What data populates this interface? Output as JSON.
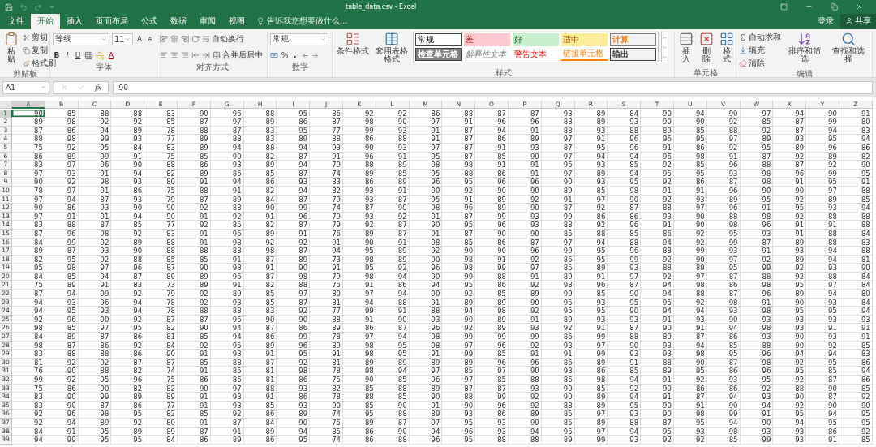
{
  "title_bar": {
    "title": "table_data.csv - Excel"
  },
  "tabs": [
    {
      "label": "文件",
      "selected": false
    },
    {
      "label": "开始",
      "selected": true
    },
    {
      "label": "插入",
      "selected": false
    },
    {
      "label": "页面布局",
      "selected": false
    },
    {
      "label": "公式",
      "selected": false
    },
    {
      "label": "数据",
      "selected": false
    },
    {
      "label": "审阅",
      "selected": false
    },
    {
      "label": "视图",
      "selected": false
    }
  ],
  "tell_me": "告诉我您想要做什么...",
  "account": {
    "sign_in": "登录",
    "share": "共享"
  },
  "ribbon": {
    "clipboard": {
      "label": "剪贴板",
      "paste": "粘贴",
      "cut": "剪切",
      "copy": "复制",
      "painter": "格式刷"
    },
    "font": {
      "label": "字体",
      "family": "等线",
      "size": "11",
      "grow": "A",
      "shrink": "A",
      "bold": "B",
      "italic": "I",
      "underline": "U",
      "font_color_letter": "A"
    },
    "alignment": {
      "label": "对齐方式",
      "wrap": "自动换行",
      "merge": "合并后居中"
    },
    "number": {
      "label": "数字",
      "format": "常规",
      "percent": "%",
      "comma": ","
    },
    "styles": {
      "label": "样式",
      "conditional": "条件格式",
      "table": "套用表格格式",
      "cells": [
        {
          "label": "常规",
          "kind": "normal"
        },
        {
          "label": "差",
          "kind": "bad"
        },
        {
          "label": "好",
          "kind": "good"
        },
        {
          "label": "适中",
          "kind": "neutral"
        },
        {
          "label": "计算",
          "kind": "calc"
        },
        {
          "label": "检查单元格",
          "kind": "check"
        },
        {
          "label": "解释性文本",
          "kind": "explanatory"
        },
        {
          "label": "警告文本",
          "kind": "warning"
        },
        {
          "label": "链接单元格",
          "kind": "linked"
        },
        {
          "label": "输出",
          "kind": "output"
        }
      ]
    },
    "cells": {
      "label": "单元格",
      "insert": "插入",
      "delete": "删除",
      "format": "格式"
    },
    "editing": {
      "label": "编辑",
      "autosum": "自动求和",
      "fill": "填充",
      "clear": "清除",
      "sort": "排序和筛选",
      "find": "查找和选择"
    }
  },
  "formula_bar": {
    "name_box": "A1",
    "function_label": "fx",
    "value": "90"
  },
  "sheet": {
    "columns": [
      {
        "label": "A",
        "selected": true
      },
      {
        "label": "B",
        "selected": false
      },
      {
        "label": "C",
        "selected": false
      },
      {
        "label": "D",
        "selected": false
      },
      {
        "label": "E",
        "selected": false
      },
      {
        "label": "F",
        "selected": false
      },
      {
        "label": "G",
        "selected": false
      },
      {
        "label": "H",
        "selected": false
      },
      {
        "label": "I",
        "selected": false
      },
      {
        "label": "J",
        "selected": false
      },
      {
        "label": "K",
        "selected": false
      },
      {
        "label": "L",
        "selected": false
      },
      {
        "label": "M",
        "selected": false
      },
      {
        "label": "N",
        "selected": false
      },
      {
        "label": "O",
        "selected": false
      },
      {
        "label": "P",
        "selected": false
      },
      {
        "label": "Q",
        "selected": false
      },
      {
        "label": "R",
        "selected": false
      },
      {
        "label": "S",
        "selected": false
      },
      {
        "label": "T",
        "selected": false
      },
      {
        "label": "U",
        "selected": false
      },
      {
        "label": "V",
        "selected": false
      },
      {
        "label": "W",
        "selected": false
      },
      {
        "label": "X",
        "selected": false
      },
      {
        "label": "Y",
        "selected": false
      },
      {
        "label": "Z",
        "selected": false
      }
    ],
    "rows": [
      {
        "header": "1",
        "selected": true,
        "cells": [
          "90",
          "85",
          "88",
          "88",
          "83",
          "90",
          "96",
          "88",
          "95",
          "86",
          "92",
          "92",
          "86",
          "88",
          "87",
          "87",
          "93",
          "89",
          "84",
          "90",
          "94",
          "90",
          "97",
          "94",
          "90",
          "91"
        ]
      },
      {
        "header": "2",
        "selected": false,
        "cells": [
          "89",
          "98",
          "92",
          "92",
          "85",
          "87",
          "97",
          "89",
          "86",
          "87",
          "98",
          "90",
          "97",
          "91",
          "96",
          "96",
          "88",
          "89",
          "93",
          "90",
          "90",
          "92",
          "85",
          "87",
          "99",
          "80"
        ]
      },
      {
        "header": "3",
        "selected": false,
        "cells": [
          "87",
          "86",
          "94",
          "89",
          "78",
          "88",
          "87",
          "83",
          "95",
          "77",
          "99",
          "93",
          "91",
          "87",
          "94",
          "91",
          "88",
          "93",
          "88",
          "89",
          "85",
          "88",
          "92",
          "87",
          "94",
          "83"
        ]
      },
      {
        "header": "4",
        "selected": false,
        "cells": [
          "88",
          "98",
          "99",
          "93",
          "77",
          "89",
          "88",
          "83",
          "89",
          "88",
          "86",
          "88",
          "91",
          "87",
          "86",
          "89",
          "97",
          "91",
          "96",
          "96",
          "95",
          "97",
          "89",
          "93",
          "95",
          "94"
        ]
      },
      {
        "header": "5",
        "selected": false,
        "cells": [
          "75",
          "92",
          "95",
          "84",
          "83",
          "89",
          "94",
          "88",
          "94",
          "93",
          "90",
          "93",
          "97",
          "87",
          "91",
          "93",
          "87",
          "95",
          "96",
          "91",
          "86",
          "92",
          "95",
          "89",
          "96",
          "86"
        ]
      },
      {
        "header": "6",
        "selected": false,
        "cells": [
          "86",
          "89",
          "99",
          "91",
          "75",
          "85",
          "90",
          "82",
          "87",
          "91",
          "96",
          "91",
          "95",
          "87",
          "85",
          "90",
          "97",
          "94",
          "94",
          "96",
          "98",
          "91",
          "87",
          "92",
          "89",
          "82"
        ]
      },
      {
        "header": "7",
        "selected": false,
        "cells": [
          "83",
          "97",
          "96",
          "90",
          "88",
          "86",
          "93",
          "89",
          "94",
          "79",
          "88",
          "89",
          "98",
          "98",
          "91",
          "91",
          "96",
          "93",
          "85",
          "92",
          "85",
          "96",
          "88",
          "87",
          "92",
          "90"
        ]
      },
      {
        "header": "8",
        "selected": false,
        "cells": [
          "97",
          "93",
          "91",
          "94",
          "82",
          "89",
          "86",
          "85",
          "87",
          "74",
          "89",
          "85",
          "95",
          "88",
          "86",
          "91",
          "97",
          "89",
          "94",
          "95",
          "95",
          "93",
          "98",
          "96",
          "99",
          "95"
        ]
      },
      {
        "header": "9",
        "selected": false,
        "cells": [
          "90",
          "92",
          "98",
          "93",
          "80",
          "91",
          "94",
          "86",
          "93",
          "83",
          "86",
          "89",
          "96",
          "95",
          "96",
          "96",
          "90",
          "93",
          "95",
          "92",
          "86",
          "87",
          "98",
          "91",
          "95",
          "91"
        ]
      },
      {
        "header": "10",
        "selected": false,
        "cells": [
          "78",
          "97",
          "91",
          "86",
          "75",
          "88",
          "91",
          "82",
          "94",
          "82",
          "93",
          "91",
          "90",
          "92",
          "90",
          "90",
          "89",
          "85",
          "98",
          "91",
          "91",
          "96",
          "90",
          "90",
          "97",
          "88"
        ]
      },
      {
        "header": "11",
        "selected": false,
        "cells": [
          "97",
          "94",
          "87",
          "93",
          "79",
          "87",
          "89",
          "84",
          "87",
          "79",
          "93",
          "87",
          "95",
          "91",
          "89",
          "92",
          "91",
          "97",
          "90",
          "92",
          "93",
          "89",
          "95",
          "92",
          "89",
          "85"
        ]
      },
      {
        "header": "12",
        "selected": false,
        "cells": [
          "90",
          "86",
          "93",
          "90",
          "90",
          "92",
          "88",
          "90",
          "99",
          "74",
          "87",
          "90",
          "98",
          "96",
          "89",
          "90",
          "87",
          "92",
          "87",
          "88",
          "97",
          "96",
          "91",
          "95",
          "93",
          "94"
        ]
      },
      {
        "header": "13",
        "selected": false,
        "cells": [
          "97",
          "91",
          "91",
          "94",
          "90",
          "91",
          "92",
          "91",
          "96",
          "79",
          "93",
          "92",
          "91",
          "87",
          "99",
          "93",
          "99",
          "86",
          "86",
          "93",
          "90",
          "88",
          "98",
          "92",
          "88",
          "88"
        ]
      },
      {
        "header": "14",
        "selected": false,
        "cells": [
          "83",
          "88",
          "87",
          "85",
          "77",
          "92",
          "85",
          "82",
          "87",
          "79",
          "92",
          "87",
          "90",
          "95",
          "96",
          "93",
          "88",
          "92",
          "96",
          "91",
          "90",
          "98",
          "96",
          "91",
          "91",
          "88"
        ]
      },
      {
        "header": "15",
        "selected": false,
        "cells": [
          "87",
          "96",
          "98",
          "92",
          "83",
          "91",
          "96",
          "89",
          "91",
          "76",
          "89",
          "87",
          "91",
          "87",
          "90",
          "90",
          "85",
          "88",
          "85",
          "86",
          "92",
          "95",
          "93",
          "91",
          "88",
          "84"
        ]
      },
      {
        "header": "16",
        "selected": false,
        "cells": [
          "84",
          "99",
          "92",
          "89",
          "88",
          "91",
          "98",
          "92",
          "92",
          "91",
          "90",
          "91",
          "98",
          "85",
          "86",
          "87",
          "97",
          "94",
          "88",
          "94",
          "92",
          "99",
          "87",
          "89",
          "88",
          "83"
        ]
      },
      {
        "header": "17",
        "selected": false,
        "cells": [
          "89",
          "87",
          "93",
          "90",
          "88",
          "88",
          "88",
          "98",
          "87",
          "94",
          "95",
          "89",
          "92",
          "90",
          "90",
          "96",
          "99",
          "95",
          "96",
          "88",
          "99",
          "93",
          "91",
          "93",
          "94",
          "88"
        ]
      },
      {
        "header": "18",
        "selected": false,
        "cells": [
          "82",
          "95",
          "92",
          "88",
          "85",
          "85",
          "91",
          "87",
          "89",
          "73",
          "98",
          "89",
          "90",
          "98",
          "91",
          "92",
          "86",
          "95",
          "99",
          "92",
          "90",
          "97",
          "92",
          "89",
          "94",
          "81"
        ]
      },
      {
        "header": "19",
        "selected": false,
        "cells": [
          "95",
          "98",
          "97",
          "96",
          "87",
          "90",
          "98",
          "91",
          "90",
          "91",
          "95",
          "92",
          "96",
          "98",
          "99",
          "97",
          "85",
          "89",
          "93",
          "88",
          "89",
          "95",
          "99",
          "92",
          "93",
          "90"
        ]
      },
      {
        "header": "20",
        "selected": false,
        "cells": [
          "84",
          "85",
          "94",
          "87",
          "80",
          "89",
          "96",
          "87",
          "98",
          "79",
          "98",
          "94",
          "90",
          "99",
          "88",
          "91",
          "89",
          "91",
          "97",
          "92",
          "97",
          "87",
          "88",
          "92",
          "88",
          "84"
        ]
      },
      {
        "header": "21",
        "selected": false,
        "cells": [
          "75",
          "89",
          "91",
          "83",
          "73",
          "89",
          "91",
          "82",
          "88",
          "75",
          "91",
          "86",
          "94",
          "95",
          "86",
          "92",
          "98",
          "96",
          "87",
          "94",
          "98",
          "86",
          "98",
          "95",
          "97",
          "84"
        ]
      },
      {
        "header": "22",
        "selected": false,
        "cells": [
          "87",
          "94",
          "99",
          "92",
          "79",
          "92",
          "89",
          "85",
          "97",
          "80",
          "97",
          "94",
          "90",
          "92",
          "85",
          "89",
          "99",
          "85",
          "90",
          "94",
          "88",
          "87",
          "96",
          "89",
          "94",
          "80"
        ]
      },
      {
        "header": "23",
        "selected": false,
        "cells": [
          "94",
          "93",
          "96",
          "94",
          "78",
          "92",
          "93",
          "85",
          "87",
          "81",
          "94",
          "88",
          "91",
          "89",
          "89",
          "90",
          "95",
          "93",
          "95",
          "95",
          "92",
          "98",
          "91",
          "90",
          "93",
          "84"
        ]
      },
      {
        "header": "24",
        "selected": false,
        "cells": [
          "94",
          "95",
          "93",
          "94",
          "78",
          "88",
          "88",
          "83",
          "92",
          "77",
          "99",
          "91",
          "88",
          "94",
          "98",
          "92",
          "95",
          "95",
          "90",
          "94",
          "94",
          "93",
          "98",
          "95",
          "95",
          "94"
        ]
      },
      {
        "header": "25",
        "selected": false,
        "cells": [
          "92",
          "96",
          "90",
          "92",
          "87",
          "87",
          "96",
          "90",
          "90",
          "88",
          "91",
          "90",
          "93",
          "90",
          "89",
          "91",
          "89",
          "93",
          "93",
          "91",
          "93",
          "90",
          "93",
          "93",
          "93",
          "93"
        ]
      },
      {
        "header": "26",
        "selected": false,
        "cells": [
          "98",
          "85",
          "97",
          "95",
          "82",
          "90",
          "94",
          "87",
          "86",
          "89",
          "86",
          "87",
          "96",
          "92",
          "89",
          "93",
          "92",
          "91",
          "87",
          "90",
          "91",
          "94",
          "98",
          "93",
          "91",
          "91"
        ]
      },
      {
        "header": "27",
        "selected": false,
        "cells": [
          "84",
          "89",
          "87",
          "86",
          "81",
          "85",
          "94",
          "86",
          "99",
          "78",
          "97",
          "94",
          "98",
          "99",
          "99",
          "99",
          "86",
          "99",
          "88",
          "89",
          "87",
          "86",
          "93",
          "90",
          "93",
          "91"
        ]
      },
      {
        "header": "28",
        "selected": false,
        "cells": [
          "98",
          "87",
          "86",
          "92",
          "84",
          "92",
          "95",
          "89",
          "96",
          "89",
          "98",
          "95",
          "98",
          "97",
          "96",
          "92",
          "93",
          "97",
          "90",
          "93",
          "94",
          "85",
          "88",
          "90",
          "92",
          "85"
        ]
      },
      {
        "header": "29",
        "selected": false,
        "cells": [
          "83",
          "88",
          "88",
          "86",
          "90",
          "91",
          "93",
          "91",
          "95",
          "91",
          "98",
          "95",
          "91",
          "99",
          "85",
          "91",
          "91",
          "99",
          "93",
          "93",
          "98",
          "95",
          "96",
          "94",
          "94",
          "83"
        ]
      },
      {
        "header": "30",
        "selected": false,
        "cells": [
          "81",
          "92",
          "92",
          "87",
          "87",
          "85",
          "88",
          "87",
          "92",
          "81",
          "89",
          "89",
          "89",
          "89",
          "96",
          "96",
          "86",
          "89",
          "91",
          "88",
          "90",
          "87",
          "98",
          "92",
          "95",
          "86"
        ]
      },
      {
        "header": "31",
        "selected": false,
        "cells": [
          "76",
          "90",
          "88",
          "82",
          "74",
          "91",
          "85",
          "81",
          "98",
          "78",
          "98",
          "94",
          "97",
          "85",
          "97",
          "90",
          "93",
          "86",
          "85",
          "89",
          "95",
          "86",
          "96",
          "95",
          "85",
          "94"
        ]
      },
      {
        "header": "32",
        "selected": false,
        "cells": [
          "99",
          "92",
          "95",
          "96",
          "75",
          "86",
          "86",
          "81",
          "86",
          "75",
          "90",
          "85",
          "96",
          "97",
          "85",
          "88",
          "86",
          "98",
          "94",
          "91",
          "92",
          "93",
          "95",
          "92",
          "87",
          "86"
        ]
      },
      {
        "header": "33",
        "selected": false,
        "cells": [
          "75",
          "86",
          "90",
          "82",
          "82",
          "90",
          "97",
          "88",
          "93",
          "82",
          "85",
          "88",
          "89",
          "87",
          "87",
          "93",
          "90",
          "85",
          "92",
          "90",
          "86",
          "86",
          "92",
          "88",
          "90",
          "85"
        ]
      },
      {
        "header": "34",
        "selected": false,
        "cells": [
          "83",
          "90",
          "99",
          "89",
          "89",
          "91",
          "93",
          "91",
          "86",
          "78",
          "88",
          "85",
          "90",
          "88",
          "99",
          "92",
          "90",
          "89",
          "94",
          "91",
          "87",
          "94",
          "93",
          "90",
          "87",
          "92"
        ]
      },
      {
        "header": "35",
        "selected": false,
        "cells": [
          "83",
          "90",
          "87",
          "86",
          "77",
          "91",
          "93",
          "85",
          "93",
          "90",
          "85",
          "90",
          "91",
          "90",
          "96",
          "92",
          "88",
          "89",
          "95",
          "90",
          "91",
          "90",
          "94",
          "92",
          "90",
          "90"
        ]
      },
      {
        "header": "36",
        "selected": false,
        "cells": [
          "92",
          "96",
          "98",
          "95",
          "82",
          "85",
          "92",
          "86",
          "89",
          "74",
          "95",
          "88",
          "89",
          "93",
          "86",
          "89",
          "85",
          "97",
          "93",
          "90",
          "98",
          "99",
          "91",
          "95",
          "94",
          "95"
        ]
      },
      {
        "header": "37",
        "selected": false,
        "cells": [
          "92",
          "94",
          "89",
          "92",
          "80",
          "91",
          "87",
          "84",
          "90",
          "75",
          "89",
          "87",
          "97",
          "95",
          "93",
          "90",
          "85",
          "89",
          "88",
          "87",
          "95",
          "94",
          "90",
          "94",
          "95",
          "95"
        ]
      },
      {
        "header": "38",
        "selected": false,
        "cells": [
          "84",
          "91",
          "95",
          "89",
          "89",
          "87",
          "91",
          "89",
          "94",
          "85",
          "86",
          "90",
          "94",
          "96",
          "93",
          "94",
          "95",
          "97",
          "94",
          "95",
          "93",
          "98",
          "93",
          "93",
          "86",
          "92"
        ]
      },
      {
        "header": "39",
        "selected": false,
        "cells": [
          "94",
          "99",
          "95",
          "95",
          "84",
          "86",
          "89",
          "86",
          "95",
          "74",
          "86",
          "88",
          "96",
          "95",
          "88",
          "88",
          "89",
          "99",
          "93",
          "92",
          "92",
          "85",
          "99",
          "93",
          "91",
          "85"
        ]
      }
    ]
  }
}
